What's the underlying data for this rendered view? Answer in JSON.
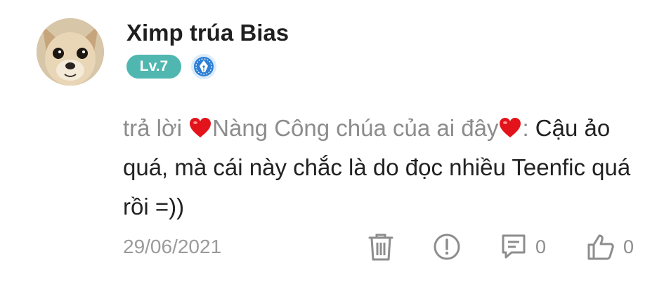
{
  "user": {
    "name": "Ximp trúa Bias",
    "level": "Lv.7",
    "avatar_icon": "chihuahua-avatar",
    "badge_icon": "pen-nib-badge-icon"
  },
  "comment": {
    "reply_label": "trả lời",
    "reply_to": "Nàng Công chúa của ai đây",
    "separator": ":",
    "text": "Cậu ảo quá, mà cái này chắc là do đọc nhiều Teenfic quá rồi =))"
  },
  "footer": {
    "date": "29/06/2021",
    "reply_count": "0",
    "like_count": "0"
  },
  "colors": {
    "level_badge": "#4fb7b0",
    "heart": "#e3131b",
    "muted_text": "#8c8c8c",
    "icon_gray": "#8d8d8d"
  }
}
